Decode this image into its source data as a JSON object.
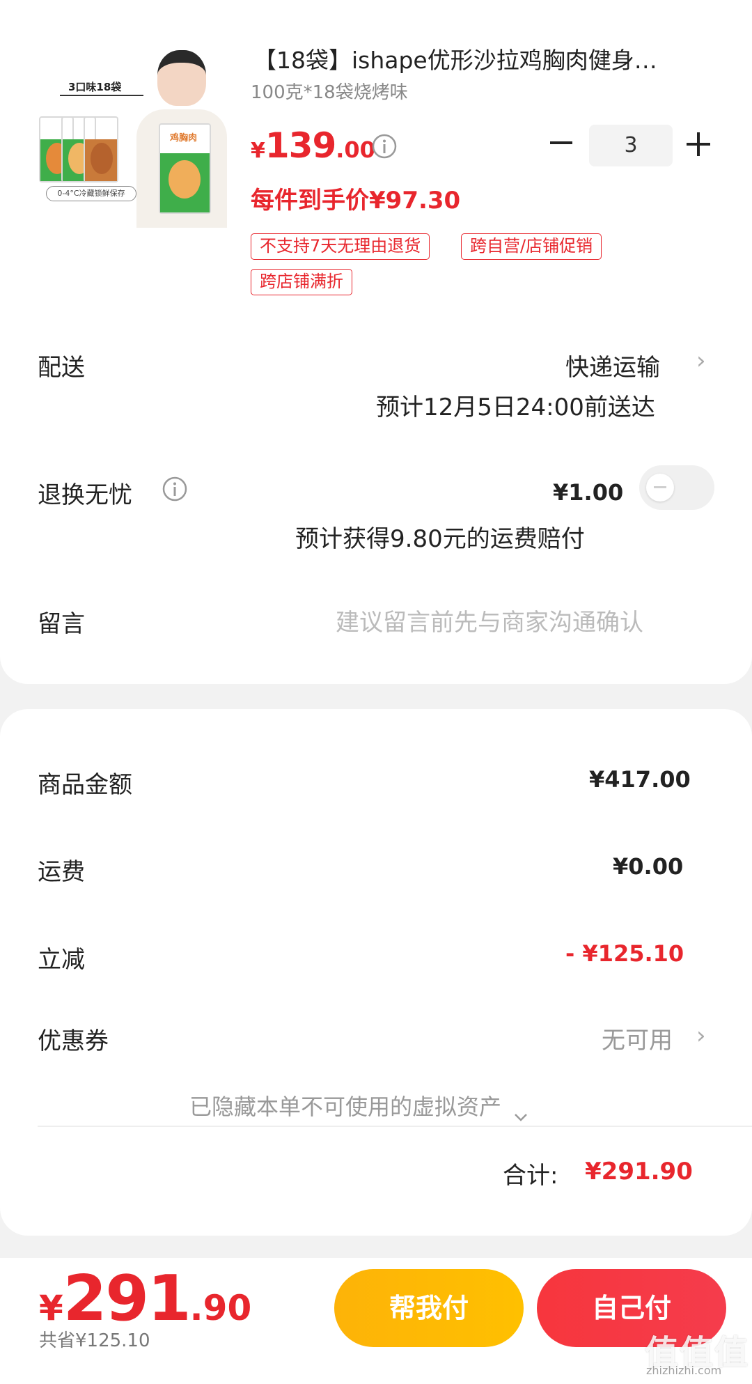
{
  "product": {
    "title": "【18袋】ishape优形沙拉鸡胸肉健身…",
    "spec": "100克*18袋烧烤味",
    "price_currency": "¥",
    "price_int": "139",
    "price_dec": ".00",
    "quantity": "3",
    "unit_price": "每件到手价¥97.30",
    "tags": [
      "不支持7天无理由退货",
      "跨自营/店铺促销",
      "跨店铺满折"
    ],
    "image_badge": "3口味18袋",
    "image_tag": "0-4°C冷藏锁鲜保存",
    "image_pack_text": "鸡胸肉"
  },
  "delivery": {
    "label": "配送",
    "method": "快递运输",
    "eta": "预计12月5日24:00前送达"
  },
  "return_insurance": {
    "label": "退换无忧",
    "price": "¥1.00",
    "note": "预计获得9.80元的运费赔付"
  },
  "message": {
    "label": "留言",
    "placeholder": "建议留言前先与商家沟通确认"
  },
  "summary": {
    "goods_label": "商品金额",
    "goods_value": "¥417.00",
    "shipping_label": "运费",
    "shipping_value": "¥0.00",
    "discount_label": "立减",
    "discount_value": "- ¥125.10",
    "coupon_label": "优惠券",
    "coupon_value": "无可用",
    "hidden_assets": "已隐藏本单不可使用的虚拟资产",
    "total_label": "合计:",
    "total_value": "¥291.90"
  },
  "footer": {
    "price_currency": "¥",
    "price_int": "291",
    "price_dec": ".90",
    "saved": "共省¥125.10",
    "help_pay": "帮我付",
    "self_pay": "自己付",
    "watermark": "值值值",
    "watermark_sub": "zhizhizhi.com"
  },
  "colors": {
    "accent_red": "#e8262d",
    "help_button": "#fdb308",
    "self_button": "#f7363d"
  }
}
